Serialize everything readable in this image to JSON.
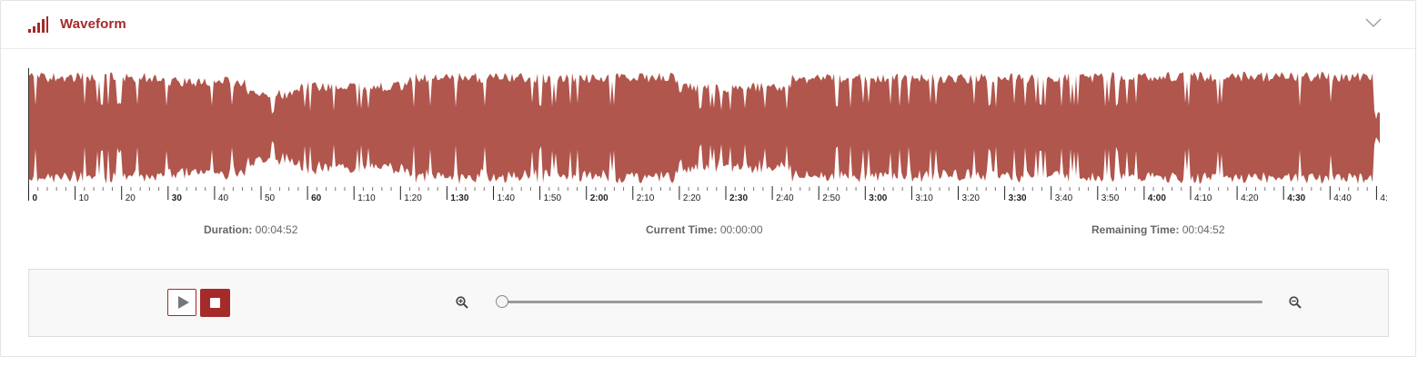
{
  "panel": {
    "title": "Waveform",
    "icons": {
      "header": "signal-bars-icon",
      "collapse": "chevron-down-icon"
    },
    "colors": {
      "accent": "#a52a2a",
      "waveform": "#b0564d"
    }
  },
  "timeline": {
    "labels": [
      "0",
      "10",
      "20",
      "30",
      "40",
      "50",
      "60",
      "1:10",
      "1:20",
      "1:30",
      "1:40",
      "1:50",
      "2:00",
      "2:10",
      "2:20",
      "2:30",
      "2:40",
      "2:50",
      "3:00",
      "3:10",
      "3:20",
      "3:30",
      "3:40",
      "3:50",
      "4:00",
      "4:10",
      "4:20",
      "4:30",
      "4:40",
      "4:"
    ],
    "bold_every": 3
  },
  "stats": {
    "duration_label": "Duration:",
    "duration_value": "00:04:52",
    "current_label": "Current Time:",
    "current_value": "00:00:00",
    "remaining_label": "Remaining Time:",
    "remaining_value": "00:04:52"
  },
  "controls": {
    "play_icon": "play-icon",
    "stop_icon": "stop-icon",
    "zoom_in_icon": "zoom-in-icon",
    "zoom_out_icon": "zoom-out-icon",
    "zoom_level": 0
  }
}
